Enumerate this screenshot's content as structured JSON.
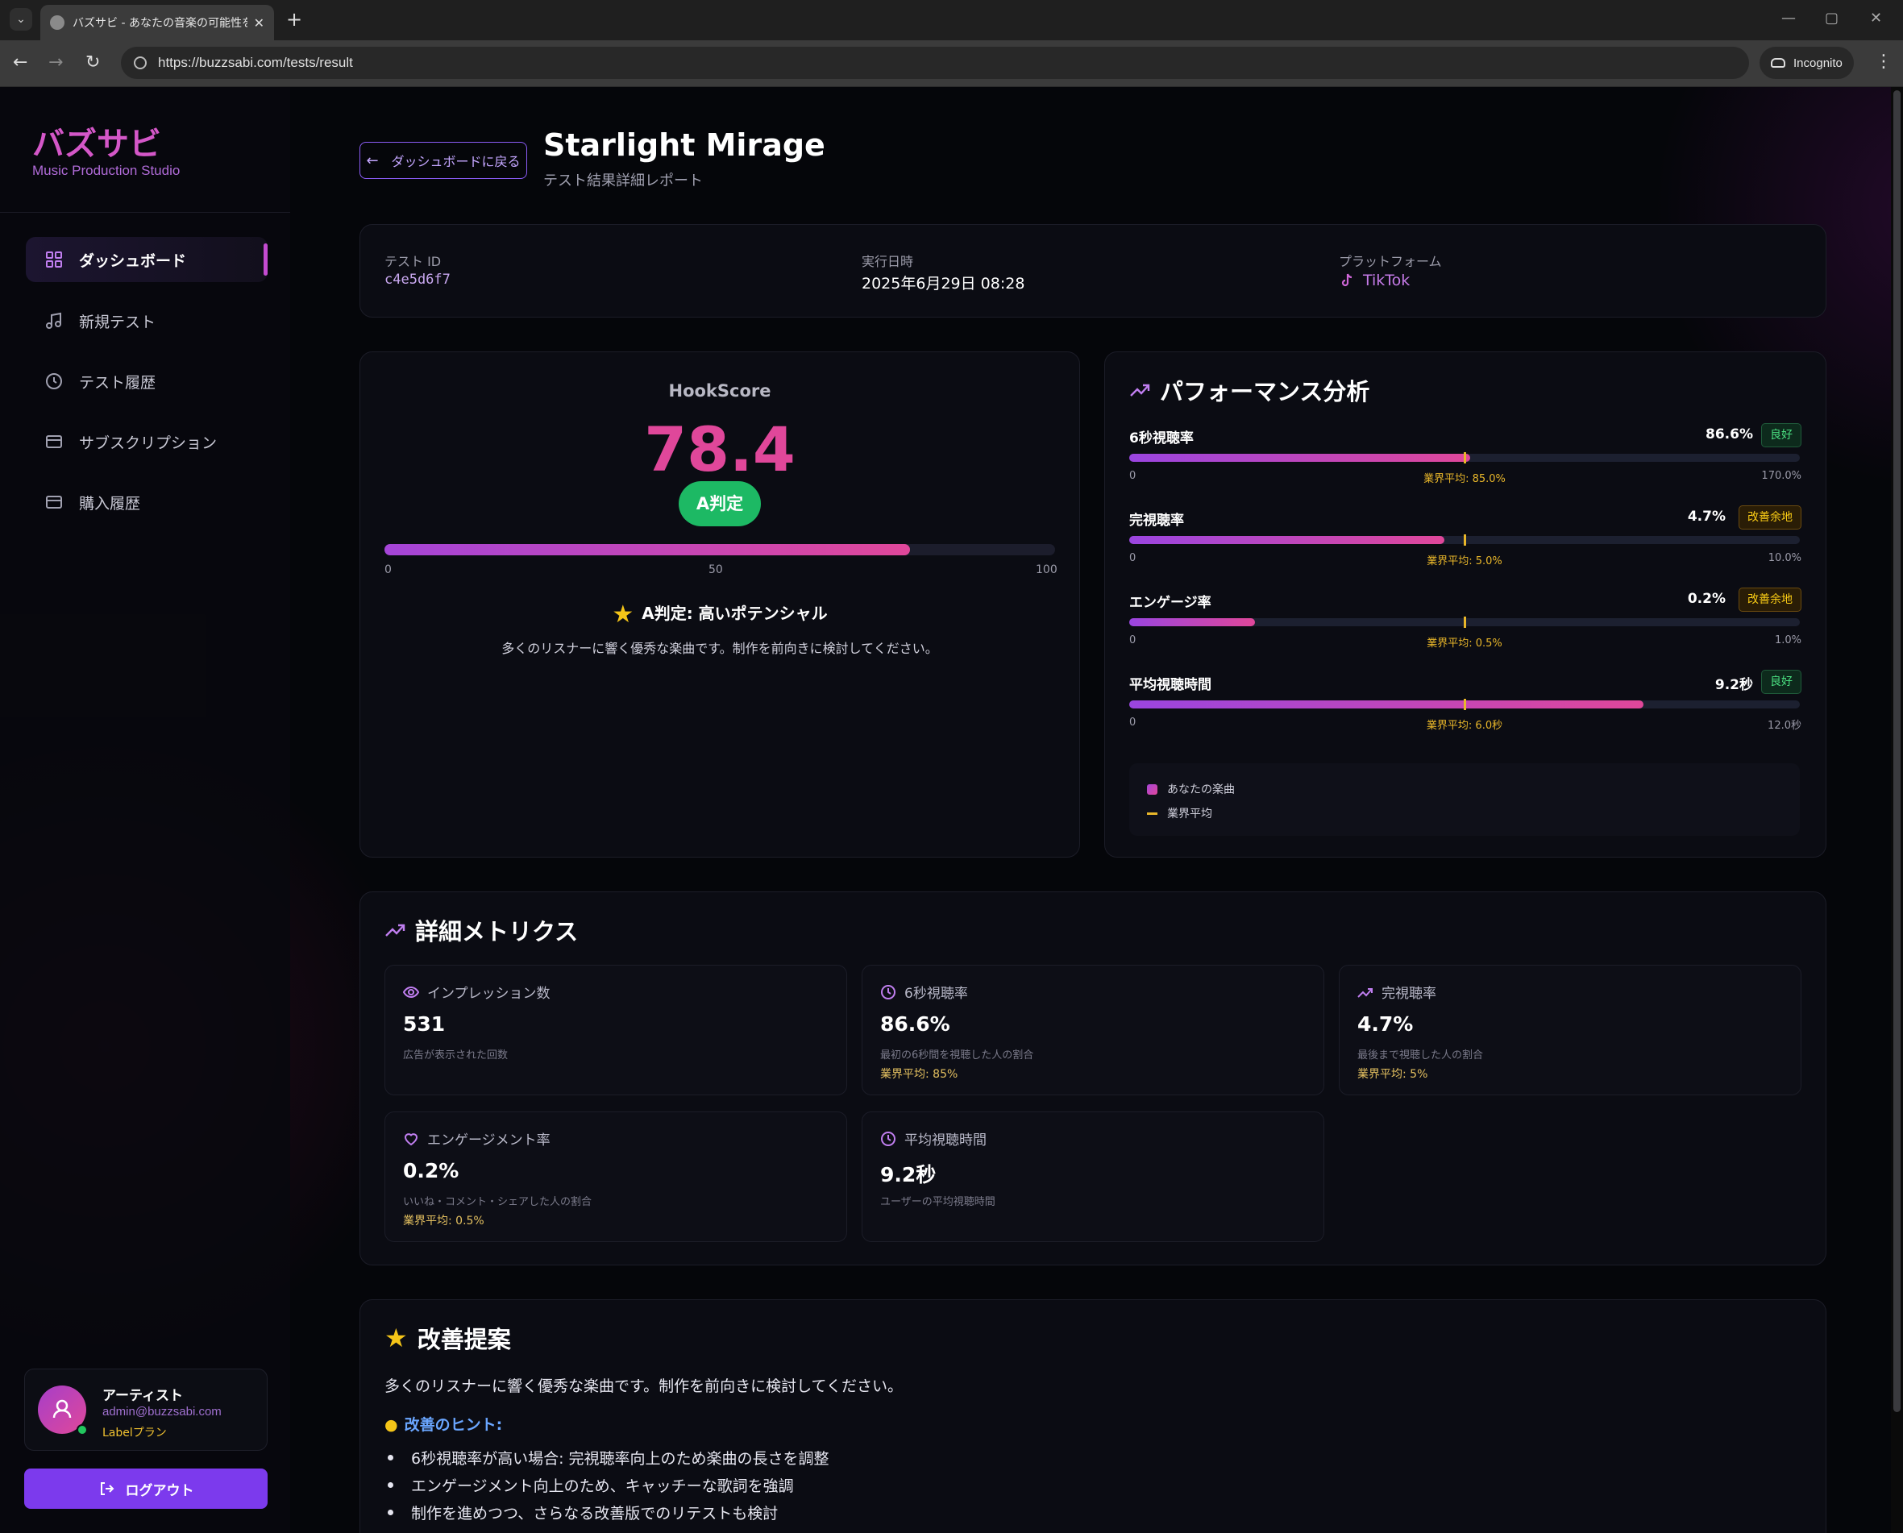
{
  "browser": {
    "tab_title": "バズサビ - あなたの音楽の可能性を",
    "url": "https://buzzsabi.com/tests/result",
    "incognito_label": "Incognito"
  },
  "sidebar": {
    "brand": "バズサビ",
    "brand_sub": "Music Production Studio",
    "items": [
      {
        "label": "ダッシュボード",
        "icon": "grid-icon",
        "active": true
      },
      {
        "label": "新規テスト",
        "icon": "music-note-icon"
      },
      {
        "label": "テスト履歴",
        "icon": "clock-icon"
      },
      {
        "label": "サブスクリプション",
        "icon": "card-icon"
      },
      {
        "label": "購入履歴",
        "icon": "card-icon"
      }
    ],
    "user": {
      "name": "アーティスト",
      "email": "admin@buzzsabi.com",
      "plan": "Labelプラン"
    },
    "logout_label": "ログアウト"
  },
  "header": {
    "back_label": "ダッシュボードに戻る",
    "title": "Starlight Mirage",
    "subtitle": "テスト結果詳細レポート"
  },
  "info": {
    "test_id_label": "テスト ID",
    "test_id": "c4e5d6f7",
    "date_label": "実行日時",
    "date": "2025年6月29日 08:28",
    "platform_label": "プラットフォーム",
    "platform": "TikTok"
  },
  "hookscore": {
    "label": "HookScore",
    "value": "78.4",
    "score": 78.4,
    "max": 100,
    "grade": "A判定",
    "ticks": [
      "0",
      "50",
      "100"
    ],
    "verdict": "A判定: 高いポテンシャル",
    "description": "多くのリスナーに響く優秀な楽曲です。制作を前向きに検討してください。"
  },
  "performance": {
    "title": "パフォーマンス分析",
    "metrics": [
      {
        "name": "6秒視聴率",
        "value": "86.6%",
        "badge": "良好",
        "status": "good",
        "ratio": 0.509,
        "avg_ratio": 0.5,
        "min": "0",
        "max": "170.0%",
        "avg_text": "業界平均: 85.0%"
      },
      {
        "name": "完視聴率",
        "value": "4.7%",
        "badge": "改善余地",
        "status": "warn",
        "ratio": 0.47,
        "avg_ratio": 0.5,
        "min": "0",
        "max": "10.0%",
        "avg_text": "業界平均: 5.0%"
      },
      {
        "name": "エンゲージ率",
        "value": "0.2%",
        "badge": "改善余地",
        "status": "warn",
        "ratio": 0.188,
        "avg_ratio": 0.5,
        "min": "0",
        "max": "1.0%",
        "avg_text": "業界平均: 0.5%"
      },
      {
        "name": "平均視聴時間",
        "value": "9.2秒",
        "badge": "良好",
        "status": "good",
        "ratio": 0.767,
        "avg_ratio": 0.5,
        "min": "0",
        "max": "12.0秒",
        "avg_text": "業界平均: 6.0秒"
      }
    ],
    "legend_yours": "あなたの楽曲",
    "legend_avg": "業界平均"
  },
  "details": {
    "title": "詳細メトリクス",
    "cards": [
      {
        "label": "インプレッション数",
        "icon": "eye-icon",
        "value": "531",
        "desc": "広告が表示された回数",
        "avg": ""
      },
      {
        "label": "6秒視聴率",
        "icon": "clock-icon",
        "value": "86.6%",
        "desc": "最初の6秒間を視聴した人の割合",
        "avg": "業界平均: 85%"
      },
      {
        "label": "完視聴率",
        "icon": "trend-icon",
        "value": "4.7%",
        "desc": "最後まで視聴した人の割合",
        "avg": "業界平均: 5%"
      },
      {
        "label": "エンゲージメント率",
        "icon": "heart-icon",
        "value": "0.2%",
        "desc": "いいね・コメント・シェアした人の割合",
        "avg": "業界平均: 0.5%"
      },
      {
        "label": "平均視聴時間",
        "icon": "clock-icon",
        "value": "9.2秒",
        "desc": "ユーザーの平均視聴時間",
        "avg": ""
      }
    ]
  },
  "suggestions": {
    "title": "改善提案",
    "text": "多くのリスナーに響く優秀な楽曲です。制作を前向きに検討してください。",
    "hint_title": "改善のヒント:",
    "hints": [
      "6秒視聴率が高い場合: 完視聴率向上のため楽曲の長さを調整",
      "エンゲージメント向上のため、キャッチーな歌詞を強調",
      "制作を進めつつ、さらなる改善版でのリテストも検討"
    ]
  },
  "colors": {
    "accent": "#e0479a",
    "purple": "#7c3aed",
    "good": "#1db964",
    "avg_line": "#e8b62a"
  }
}
